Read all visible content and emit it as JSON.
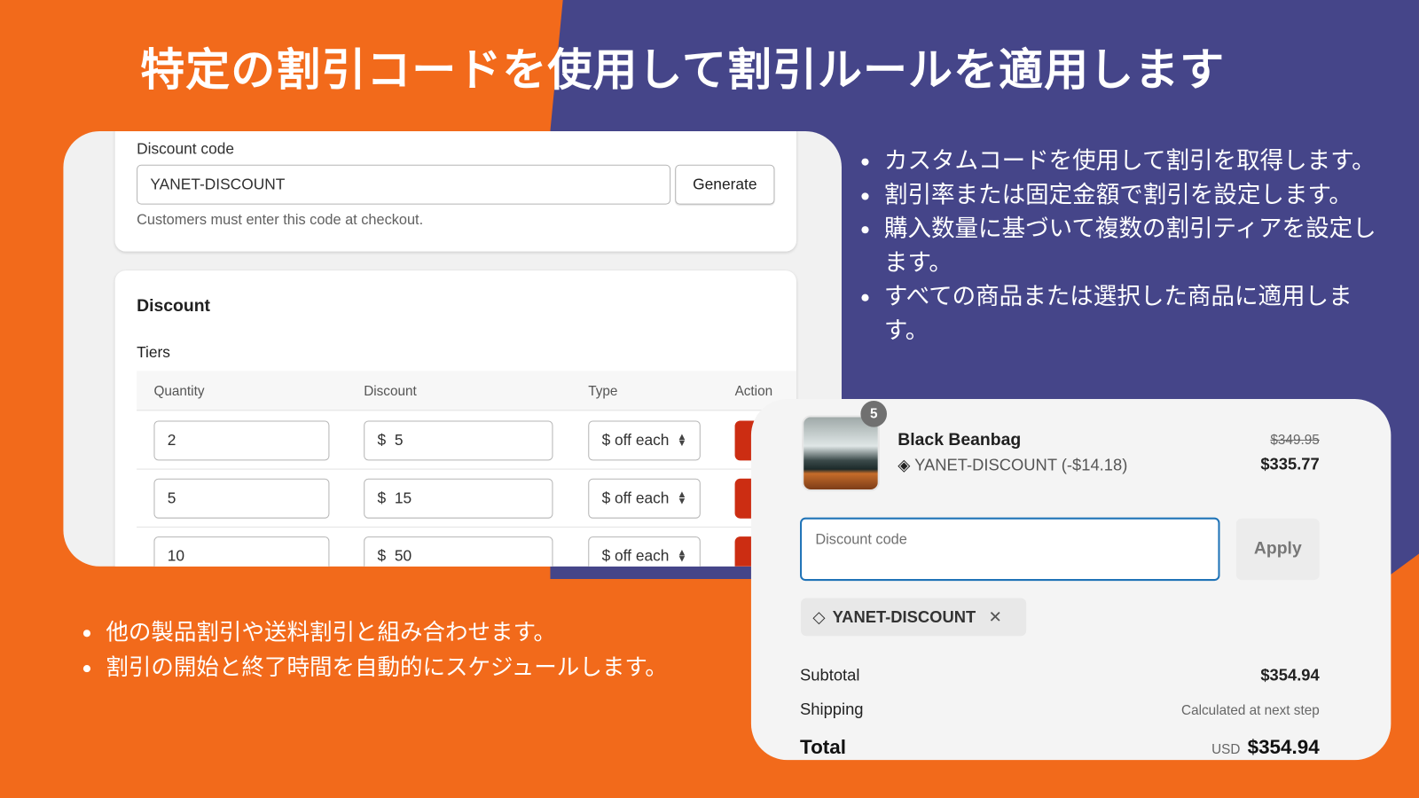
{
  "title": "特定の割引コードを使用して割引ルールを適用します",
  "right_bullets": [
    "カスタムコードを使用して割引を取得します。",
    "割引率または固定金額で割引を設定します。",
    "購入数量に基づいて複数の割引ティアを設定します。",
    "すべての商品または選択した商品に適用します。"
  ],
  "left_bullets": [
    "他の製品割引や送料割引と組み合わせます。",
    "割引の開始と終了時間を自動的にスケジュールします。"
  ],
  "admin": {
    "discount_code_label": "Discount code",
    "discount_code_value": "YANET-DISCOUNT",
    "generate_label": "Generate",
    "help_text": "Customers must enter this code at checkout.",
    "discount_heading": "Discount",
    "tiers_heading": "Tiers",
    "columns": [
      "Quantity",
      "Discount",
      "Type",
      "Action"
    ],
    "tiers": [
      {
        "quantity": "2",
        "currency": "$",
        "discount": "5",
        "type": "$ off each"
      },
      {
        "quantity": "5",
        "currency": "$",
        "discount": "15",
        "type": "$ off each"
      },
      {
        "quantity": "10",
        "currency": "$",
        "discount": "50",
        "type": "$ off each"
      }
    ]
  },
  "checkout": {
    "item_quantity": "5",
    "product_name": "Black Beanbag",
    "applied_discount": "YANET-DISCOUNT (-$14.18)",
    "original_price": "$349.95",
    "price": "$335.77",
    "discount_placeholder": "Discount code",
    "apply_label": "Apply",
    "discount_tag": "YANET-DISCOUNT",
    "subtotal_label": "Subtotal",
    "subtotal_value": "$354.94",
    "shipping_label": "Shipping",
    "shipping_value": "Calculated at next step",
    "total_label": "Total",
    "total_currency": "USD",
    "total_value": "$354.94"
  },
  "colors": {
    "orange": "#f26a1b",
    "purple": "#454589",
    "delete_red": "#cc2d12",
    "focus_blue": "#1f73b7"
  }
}
